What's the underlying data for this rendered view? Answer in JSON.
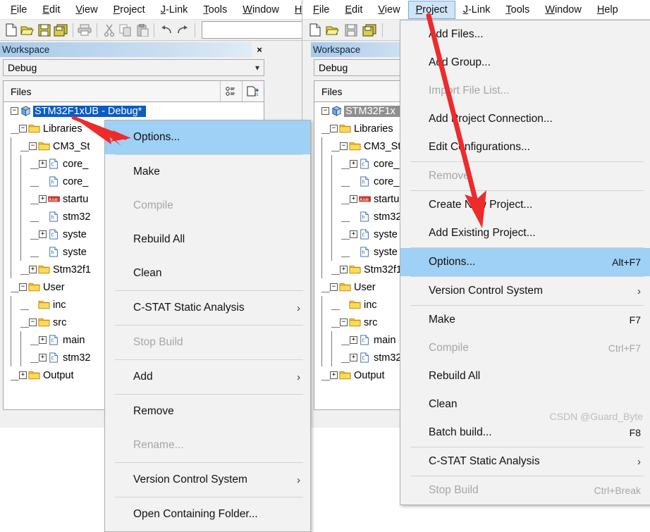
{
  "app": {
    "menubar_items": [
      {
        "label": "File",
        "mnemonic": "F"
      },
      {
        "label": "Edit",
        "mnemonic": "E"
      },
      {
        "label": "View",
        "mnemonic": "V"
      },
      {
        "label": "Project",
        "mnemonic": "P"
      },
      {
        "label": "J-Link",
        "mnemonic": "J"
      },
      {
        "label": "Tools",
        "mnemonic": "T"
      },
      {
        "label": "Window",
        "mnemonic": "W"
      },
      {
        "label": "Help",
        "mnemonic": "H"
      }
    ],
    "toolbar_icons": [
      "new-file-icon",
      "open-folder-icon",
      "save-icon",
      "save-all-icon",
      "print-icon",
      "cut-icon",
      "copy-icon",
      "paste-icon",
      "undo-icon",
      "redo-icon"
    ],
    "search_value": ""
  },
  "workspace": {
    "title": "Workspace",
    "close_label": "×",
    "configuration": "Debug",
    "files_header": "Files",
    "header_buttons": [
      "overview-icon",
      "export-icon"
    ]
  },
  "tree": {
    "root": "STM32F1xUB - Debug*",
    "root_short": "STM32F1x",
    "nodes": [
      {
        "label": "Libraries",
        "type": "folder",
        "depth": 1,
        "expander": "-"
      },
      {
        "label": "CM3_St",
        "type": "folder",
        "depth": 2,
        "expander": "-"
      },
      {
        "label": "core_",
        "type": "c-file",
        "depth": 3,
        "expander": "+"
      },
      {
        "label": "core_",
        "type": "h-file",
        "depth": 3,
        "expander": ""
      },
      {
        "label": "startu",
        "type": "asm-file",
        "depth": 3,
        "expander": "+"
      },
      {
        "label": "stm32",
        "type": "h-file",
        "depth": 3,
        "expander": ""
      },
      {
        "label": "syste",
        "type": "c-file",
        "depth": 3,
        "expander": "+"
      },
      {
        "label": "syste",
        "type": "h-file",
        "depth": 3,
        "expander": ""
      },
      {
        "label": "Stm32f1",
        "type": "folder",
        "depth": 2,
        "expander": "+"
      },
      {
        "label": "User",
        "type": "folder",
        "depth": 1,
        "expander": "-"
      },
      {
        "label": "inc",
        "type": "folder",
        "depth": 2,
        "expander": ""
      },
      {
        "label": "src",
        "type": "folder",
        "depth": 2,
        "expander": "-"
      },
      {
        "label": "main",
        "type": "c-file",
        "depth": 3,
        "expander": "+"
      },
      {
        "label": "stm32",
        "type": "c-file",
        "depth": 3,
        "expander": "+"
      },
      {
        "label": "Output",
        "type": "folder",
        "depth": 1,
        "expander": "+"
      }
    ]
  },
  "context_menu": {
    "items": [
      {
        "label": "Options...",
        "accel": "",
        "state": "highlighted",
        "submenu": false
      },
      {
        "sep": true
      },
      {
        "label": "Make",
        "accel": "",
        "state": "normal",
        "submenu": false
      },
      {
        "label": "Compile",
        "accel": "",
        "state": "disabled",
        "submenu": false
      },
      {
        "label": "Rebuild All",
        "accel": "",
        "state": "normal",
        "submenu": false
      },
      {
        "label": "Clean",
        "accel": "",
        "state": "normal",
        "submenu": false
      },
      {
        "sep": true
      },
      {
        "label": "C-STAT Static Analysis",
        "accel": "",
        "state": "normal",
        "submenu": true
      },
      {
        "sep": true
      },
      {
        "label": "Stop Build",
        "accel": "",
        "state": "disabled",
        "submenu": false
      },
      {
        "sep": true
      },
      {
        "label": "Add",
        "accel": "",
        "state": "normal",
        "submenu": true
      },
      {
        "sep": true
      },
      {
        "label": "Remove",
        "accel": "",
        "state": "normal",
        "submenu": false
      },
      {
        "label": "Rename...",
        "accel": "",
        "state": "disabled",
        "submenu": false
      },
      {
        "sep": true
      },
      {
        "label": "Version Control System",
        "accel": "",
        "state": "normal",
        "submenu": true
      },
      {
        "sep": true
      },
      {
        "label": "Open Containing Folder...",
        "accel": "",
        "state": "normal",
        "submenu": false
      }
    ]
  },
  "project_menu": {
    "items": [
      {
        "label": "Add Files...",
        "accel": "",
        "state": "normal",
        "submenu": false
      },
      {
        "label": "Add Group...",
        "accel": "",
        "state": "normal",
        "submenu": false
      },
      {
        "label": "Import File List...",
        "accel": "",
        "state": "disabled",
        "submenu": false
      },
      {
        "label": "Add Project Connection...",
        "accel": "",
        "state": "normal",
        "submenu": false
      },
      {
        "label": "Edit Configurations...",
        "accel": "",
        "state": "normal",
        "submenu": false
      },
      {
        "sep": true
      },
      {
        "label": "Remove",
        "accel": "",
        "state": "disabled",
        "submenu": false
      },
      {
        "sep": true
      },
      {
        "label": "Create New Project...",
        "accel": "",
        "state": "normal",
        "submenu": false
      },
      {
        "label": "Add Existing Project...",
        "accel": "",
        "state": "normal",
        "submenu": false
      },
      {
        "sep": true
      },
      {
        "label": "Options...",
        "accel": "Alt+F7",
        "state": "highlighted",
        "submenu": false
      },
      {
        "sep": true
      },
      {
        "label": "Version Control System",
        "accel": "",
        "state": "normal",
        "submenu": true
      },
      {
        "sep": true
      },
      {
        "label": "Make",
        "accel": "F7",
        "state": "normal",
        "submenu": false
      },
      {
        "label": "Compile",
        "accel": "Ctrl+F7",
        "state": "disabled",
        "submenu": false
      },
      {
        "label": "Rebuild All",
        "accel": "",
        "state": "normal",
        "submenu": false
      },
      {
        "label": "Clean",
        "accel": "",
        "state": "normal",
        "submenu": false
      },
      {
        "label": "Batch build...",
        "accel": "F8",
        "state": "normal",
        "submenu": false
      },
      {
        "sep": true
      },
      {
        "label": "C-STAT Static Analysis",
        "accel": "",
        "state": "normal",
        "submenu": true
      },
      {
        "sep": true
      },
      {
        "label": "Stop Build",
        "accel": "Ctrl+Break",
        "state": "disabled",
        "submenu": false
      }
    ]
  },
  "annotations": {
    "watermark": "CSDN @Guard_Byte",
    "arrow_color": "#ee2b2b"
  }
}
